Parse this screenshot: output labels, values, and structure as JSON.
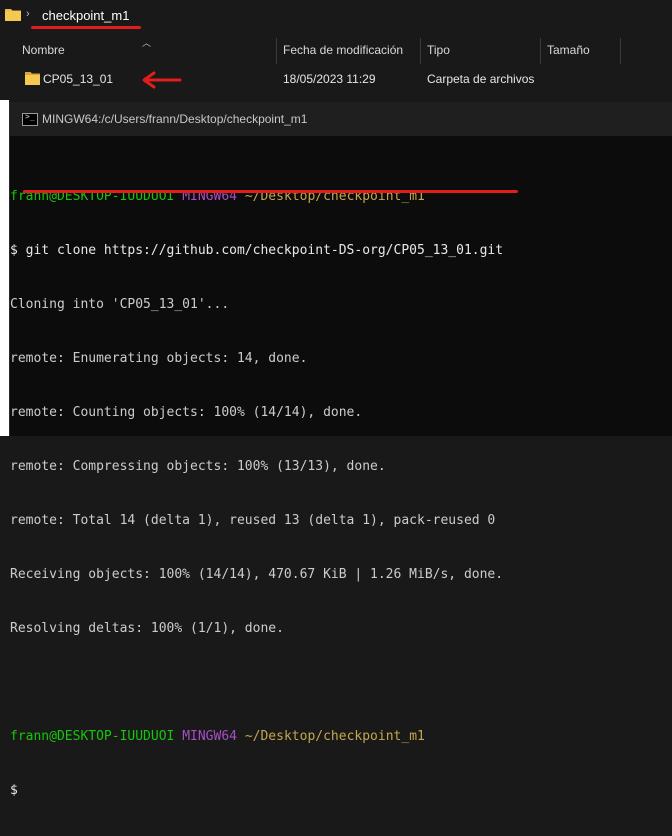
{
  "explorer": {
    "breadcrumb": "checkpoint_m1",
    "columns": [
      "Nombre",
      "Fecha de modificación",
      "Tipo",
      "Tamaño"
    ],
    "rows": [
      {
        "name": "CP05_13_01",
        "modified": "18/05/2023 11:29",
        "type": "Carpeta de archivos",
        "size": ""
      }
    ],
    "accent": "#e11d1d",
    "folder_color": "#e8b84a"
  },
  "terminal": {
    "title": "MINGW64:/c/Users/frann/Desktop/checkpoint_m1",
    "prompt": {
      "user": "frann@DESKTOP-IUUDUOI",
      "env": "MINGW64",
      "path": "~/Desktop/checkpoint_m1"
    },
    "command": "git clone https://github.com/checkpoint-DS-org/CP05_13_01.git",
    "output": [
      "Cloning into 'CP05_13_01'...",
      "remote: Enumerating objects: 14, done.",
      "remote: Counting objects: 100% (14/14), done.",
      "remote: Compressing objects: 100% (13/13), done.",
      "remote: Total 14 (delta 1), reused 13 (delta 1), pack-reused 0",
      "Receiving objects: 100% (14/14), 470.67 KiB | 1.26 MiB/s, done.",
      "Resolving deltas: 100% (1/1), done."
    ],
    "dollar": "$",
    "colors": {
      "user": "#16c60c",
      "env": "#a64fc5",
      "path": "#c3a74d"
    }
  }
}
